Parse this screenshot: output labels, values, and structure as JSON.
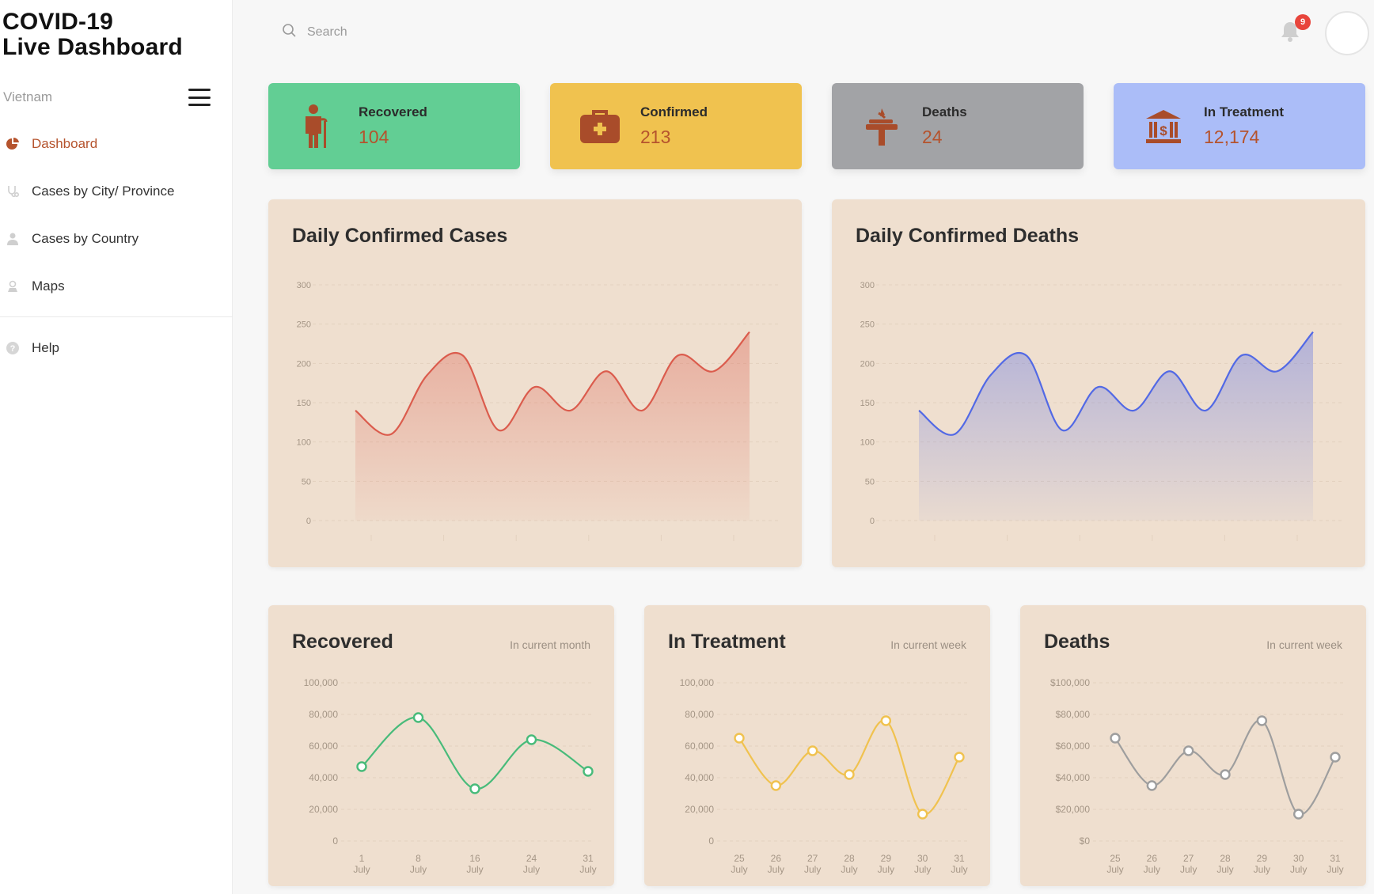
{
  "sidebar": {
    "brand_title": "COVID-19\nLive Dashboard",
    "region_label": "Vietnam",
    "nav_items": [
      {
        "label": "Dashboard",
        "icon": "pie-chart-icon",
        "active": true
      },
      {
        "label": "Cases by City/ Province",
        "icon": "stethoscope-icon",
        "active": false
      },
      {
        "label": "Cases by Country",
        "icon": "person-icon",
        "active": false
      },
      {
        "label": "Maps",
        "icon": "pin-icon",
        "active": false
      }
    ],
    "help_label": "Help"
  },
  "topbar": {
    "search_placeholder": "Search",
    "notification_count": "9"
  },
  "stats": [
    {
      "label": "Recovered",
      "value": "104",
      "bg": "#62ce94",
      "icon": "person-recovered-icon"
    },
    {
      "label": "Confirmed",
      "value": "213",
      "bg": "#f0c24f",
      "icon": "medical-kit-icon"
    },
    {
      "label": "Deaths",
      "value": "24",
      "bg": "#a2a3a6",
      "icon": "coffin-icon"
    },
    {
      "label": "In Treatment",
      "value": "12,174",
      "bg": "#abbdf8",
      "icon": "hospital-icon"
    }
  ],
  "colors": {
    "accent": "#b5532d",
    "panel_bg": "#efdfcf",
    "red_line": "#db5c4d",
    "blue_line": "#5269e5",
    "green_line": "#48bb7a",
    "yellow_line": "#f0c24f",
    "gray_line": "#9e9e9e"
  },
  "chart_data": [
    {
      "type": "area",
      "title": "Daily Confirmed Cases",
      "y_ticks": [
        "300",
        "250",
        "200",
        "150",
        "100",
        "50",
        "0"
      ],
      "ylim": [
        0,
        300
      ],
      "x": [
        0,
        1,
        2,
        3,
        4,
        5,
        6,
        7,
        8,
        9,
        10,
        11
      ],
      "series": [
        {
          "values": [
            140,
            110,
            185,
            210,
            115,
            170,
            140,
            190,
            140,
            210,
            190,
            240
          ],
          "color": "#db5c4d"
        }
      ]
    },
    {
      "type": "area",
      "title": "Daily Confirmed Deaths",
      "y_ticks": [
        "300",
        "250",
        "200",
        "150",
        "100",
        "50",
        "0"
      ],
      "ylim": [
        0,
        300
      ],
      "x": [
        0,
        1,
        2,
        3,
        4,
        5,
        6,
        7,
        8,
        9,
        10,
        11
      ],
      "series": [
        {
          "values": [
            140,
            110,
            185,
            210,
            115,
            170,
            140,
            190,
            140,
            210,
            190,
            240
          ],
          "color": "#5269e5"
        }
      ]
    },
    {
      "type": "line",
      "title": "Recovered",
      "subtitle": "In current month",
      "y_ticks": [
        "100,000",
        "80,000",
        "60,000",
        "40,000",
        "20,000",
        "0"
      ],
      "ylim": [
        0,
        100000
      ],
      "categories": [
        "1\nJuly",
        "8\nJuly",
        "16\nJuly",
        "24\nJuly",
        "31\nJuly"
      ],
      "series": [
        {
          "values": [
            47000,
            78000,
            33000,
            64000,
            44000
          ],
          "color": "#48bb7a"
        }
      ]
    },
    {
      "type": "line",
      "title": "In Treatment",
      "subtitle": "In current  week",
      "y_ticks": [
        "100,000",
        "80,000",
        "60,000",
        "40,000",
        "20,000",
        "0"
      ],
      "ylim": [
        0,
        100000
      ],
      "categories": [
        "25\nJuly",
        "26\nJuly",
        "27\nJuly",
        "28\nJuly",
        "29\nJuly",
        "30\nJuly",
        "31\nJuly"
      ],
      "series": [
        {
          "values": [
            65000,
            35000,
            57000,
            42000,
            76000,
            17000,
            53000
          ],
          "color": "#f0c24f"
        }
      ]
    },
    {
      "type": "line",
      "title": "Deaths",
      "subtitle": "In current week",
      "y_ticks": [
        "$100,000",
        "$80,000",
        "$60,000",
        "$40,000",
        "$20,000",
        "$0"
      ],
      "ylim": [
        0,
        100000
      ],
      "categories": [
        "25\nJuly",
        "26\nJuly",
        "27\nJuly",
        "28\nJuly",
        "29\nJuly",
        "30\nJuly",
        "31\nJuly"
      ],
      "series": [
        {
          "values": [
            65000,
            35000,
            57000,
            42000,
            76000,
            17000,
            53000
          ],
          "color": "#9e9e9e"
        }
      ]
    }
  ]
}
